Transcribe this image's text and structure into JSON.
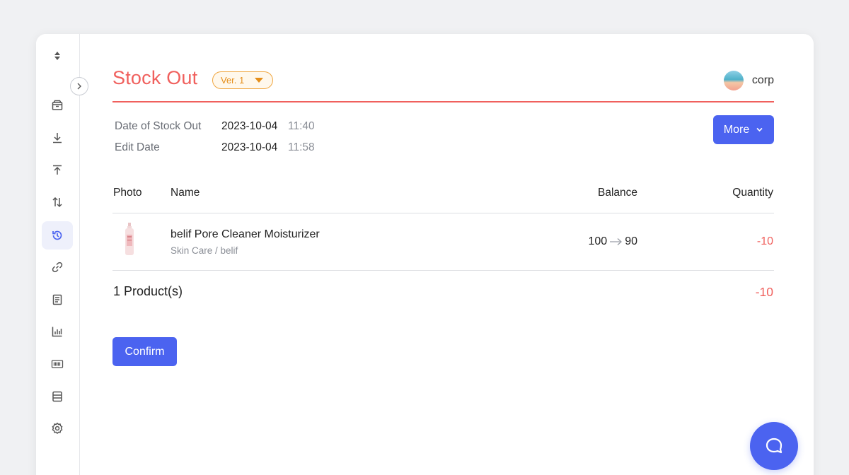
{
  "header": {
    "title": "Stock Out",
    "version": "Ver. 1",
    "user": "corp"
  },
  "meta": {
    "stock_out_label": "Date of Stock Out",
    "stock_out_date": "2023-10-04",
    "stock_out_time": "11:40",
    "edit_label": "Edit Date",
    "edit_date": "2023-10-04",
    "edit_time": "11:58"
  },
  "actions": {
    "more": "More",
    "confirm": "Confirm"
  },
  "table": {
    "columns": {
      "photo": "Photo",
      "name": "Name",
      "balance": "Balance",
      "quantity": "Quantity"
    },
    "rows": [
      {
        "name": "belif Pore Cleaner Moisturizer",
        "category": "Skin Care / belif",
        "balance_from": "100",
        "balance_to": "90",
        "quantity": "-10"
      }
    ],
    "total_label": "1 Product(s)",
    "total_quantity": "-10"
  },
  "sidebar": {
    "icons": [
      "sort-icon",
      "box-icon",
      "stock-in-icon",
      "stock-out-icon",
      "transfer-icon",
      "history-icon",
      "link-icon",
      "document-icon",
      "chart-icon",
      "barcode-icon",
      "table-icon",
      "settings-icon"
    ],
    "active": "history-icon"
  },
  "colors": {
    "accent": "#4b63f0",
    "title_red": "#f0605d",
    "badge_orange": "#e58e1a",
    "sidebar_active_bg": "#eef0fb"
  }
}
